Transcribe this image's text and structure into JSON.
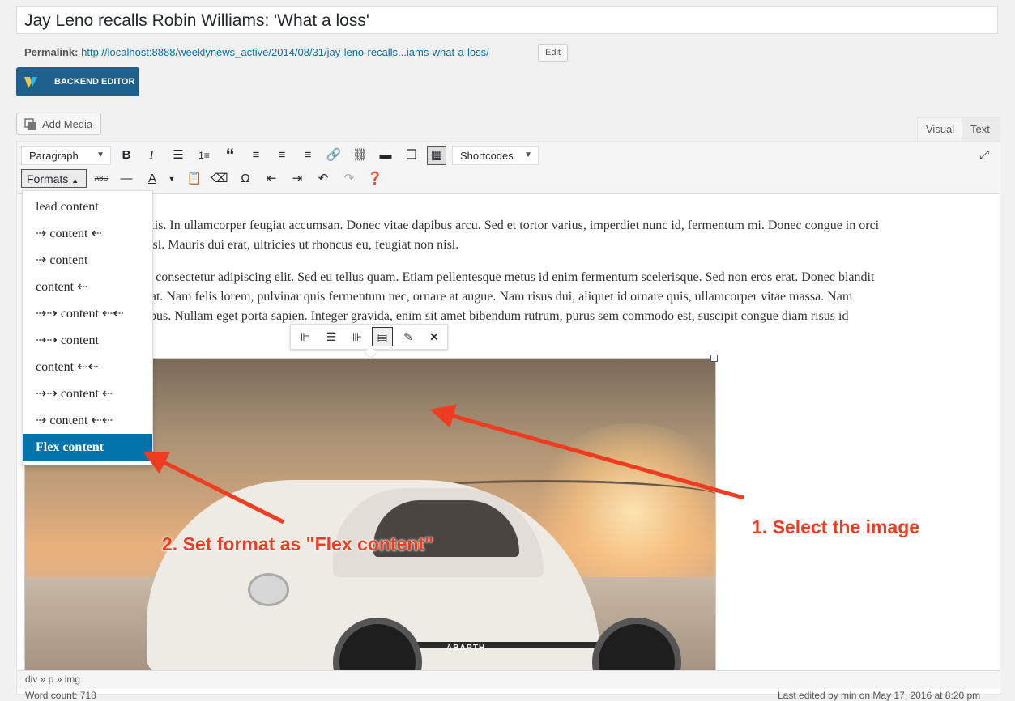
{
  "post": {
    "title": "Jay Leno recalls Robin Williams: 'What a loss'",
    "permalink_label": "Permalink:",
    "permalink_url": "http://localhost:8888/weeklynews_active/2014/08/31/jay-leno-recalls...iams-what-a-loss/",
    "edit_label": "Edit"
  },
  "backend_editor_label": "BACKEND EDITOR",
  "add_media_label": "Add Media",
  "tabs": {
    "visual": "Visual",
    "text": "Text"
  },
  "toolbar": {
    "paragraph_select": "Paragraph",
    "shortcodes_select": "Shortcodes",
    "formats_label": "Formats"
  },
  "formats_menu": [
    "lead content",
    "⇢ content ⇠",
    "⇢ content",
    "content ⇠",
    "⇢⇢ content ⇠⇠",
    "⇢⇢ content",
    "content ⇠⇠",
    "⇢⇢ content ⇠",
    "⇢ content ⇠⇠",
    "Flex content"
  ],
  "content": {
    "p1_line1": "enenatis. In ullamcorper feugiat accumsan. Donec vitae dapibus arcu. Sed et tortor varius, imperdiet nunc id, fermentum mi. Donec congue in orci",
    "p1_line2": "gue nisl. Mauris dui erat, ultricies ut rhoncus eu, feugiat non nisl.",
    "p2_line1": " amet, consectetur adipiscing elit. Sed eu tellus quam. Etiam pellentesque metus id enim fermentum scelerisque. Sed non eros erat. Donec blandit",
    "p2_line2": " feugiat. Nam felis lorem, pulvinar quis fermentum nec, ornare at augue. Nam risus dui, aliquet id ornare quis, ullamcorper vitae massa. Nam",
    "p2_line3": " faucibus. Nullam eget porta sapien. Integer gravida, enim sit amet bibendum rutrum, purus sem commodo est, suscipit congue diam risus id",
    "car_badge": "ABARTH"
  },
  "status_path": "div » p » img",
  "word_count": "Word count: 718",
  "last_edited": "Last edited by min on May 17, 2016 at 8:20 pm",
  "annotations": {
    "step1": "1. Select the image",
    "step2": "2. Set format as \"Flex content\""
  },
  "colors": {
    "accent": "#0073aa",
    "annotation": "#ef3b1f"
  }
}
